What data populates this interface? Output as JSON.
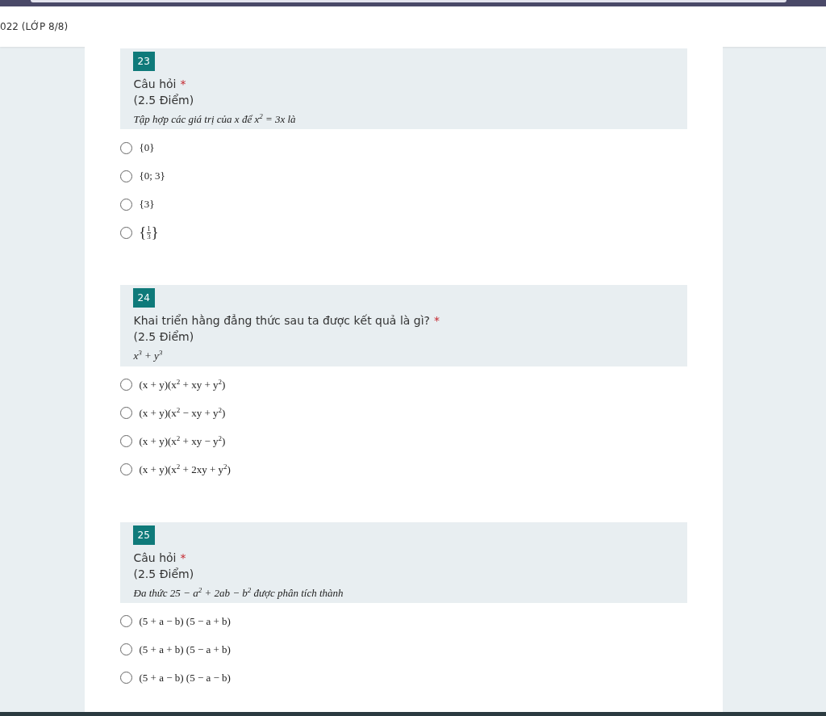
{
  "header": {
    "title": "022 (LỚP 8/8)"
  },
  "questions": [
    {
      "number": "23",
      "title": "Câu hỏi",
      "required_mark": "*",
      "points": "(2.5 Điểm)",
      "prompt": "Tập hợp các giá trị của x để x$^{2}$ = 3x là",
      "options": [
        {
          "kind": "text",
          "text": "{0}",
          "selected": false
        },
        {
          "kind": "text",
          "text": "{0; 3}",
          "selected": false
        },
        {
          "kind": "text",
          "text": "{3}",
          "selected": false
        },
        {
          "kind": "fraction",
          "open": "{",
          "numerator": "1",
          "denominator": "3",
          "close": "}",
          "selected": false
        }
      ]
    },
    {
      "number": "24",
      "title": "Khai triển hằng đẳng thức sau ta được kết quả là gì?",
      "required_mark": "*",
      "points": "(2.5 Điểm)",
      "prompt": "x$^{3}$ + y$^{3}$",
      "options": [
        {
          "kind": "text",
          "text": "(x + y)(x$^{2}$ + xy + y$^{2}$)",
          "selected": false
        },
        {
          "kind": "text",
          "text": "(x + y)(x$^{2}$ − xy + y$^{2}$)",
          "selected": false
        },
        {
          "kind": "text",
          "text": "(x + y)(x$^{2}$ + xy − y$^{2}$)",
          "selected": false
        },
        {
          "kind": "text",
          "text": "(x + y)(x$^{2}$ + 2xy + y$^{2}$)",
          "selected": false
        }
      ]
    },
    {
      "number": "25",
      "title": "Câu hỏi",
      "required_mark": "*",
      "points": "(2.5 Điểm)",
      "prompt": "Đa thức 25 − a$^{2}$ + 2ab − b$^{2}$ được phân tích thành",
      "options": [
        {
          "kind": "text",
          "text": "(5 + a − b) (5 − a + b)",
          "selected": false
        },
        {
          "kind": "text",
          "text": "(5 + a + b) (5 − a + b)",
          "selected": false
        },
        {
          "kind": "text",
          "text": "(5 + a − b) (5 − a − b)",
          "selected": false
        }
      ]
    }
  ]
}
